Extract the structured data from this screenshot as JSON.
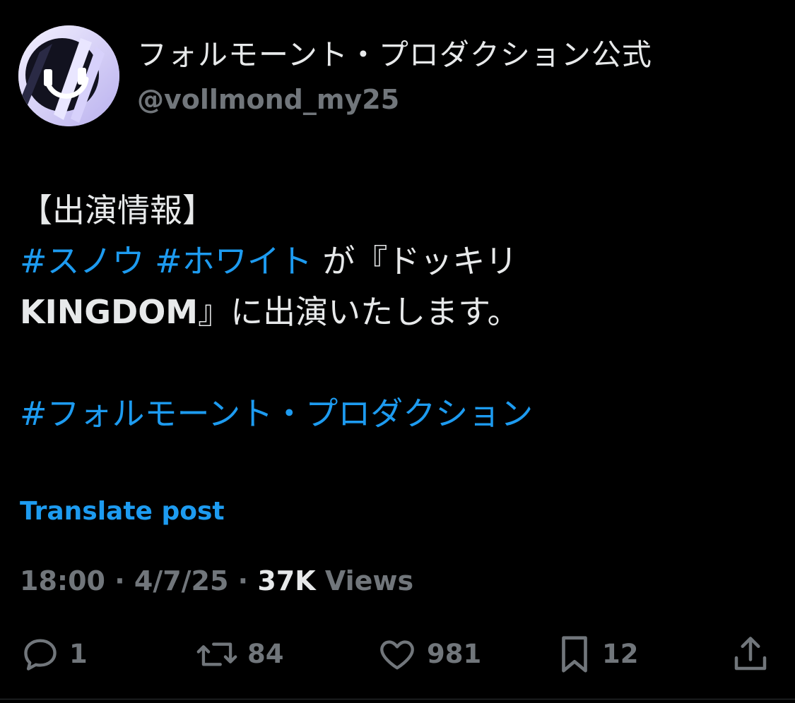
{
  "author": {
    "display_name": "フォルモーント・プロダクション公式",
    "handle": "@vollmond_my25",
    "avatar_icon": "moon-logo-icon"
  },
  "post": {
    "line1": "【出演情報】",
    "line2": {
      "hashtag1": "#スノウ",
      "hashtag2": "#ホワイト",
      "text": " が『ドッキリ"
    },
    "line3": {
      "latin": "KINGDOM",
      "text": "』に出演いたします。"
    },
    "hashtag_line": "#フォルモーント・プロダクション"
  },
  "translate_label": "Translate post",
  "meta": {
    "time": "18:00",
    "separator": " · ",
    "date": "4/7/25",
    "views_count": "37K",
    "views_label": " Views"
  },
  "actions": {
    "reply_count": "1",
    "repost_count": "84",
    "like_count": "981",
    "bookmark_count": "12"
  },
  "colors": {
    "background": "#000000",
    "text_primary": "#e7e9ea",
    "text_secondary": "#71767b",
    "link_blue": "#1d9bf0"
  }
}
